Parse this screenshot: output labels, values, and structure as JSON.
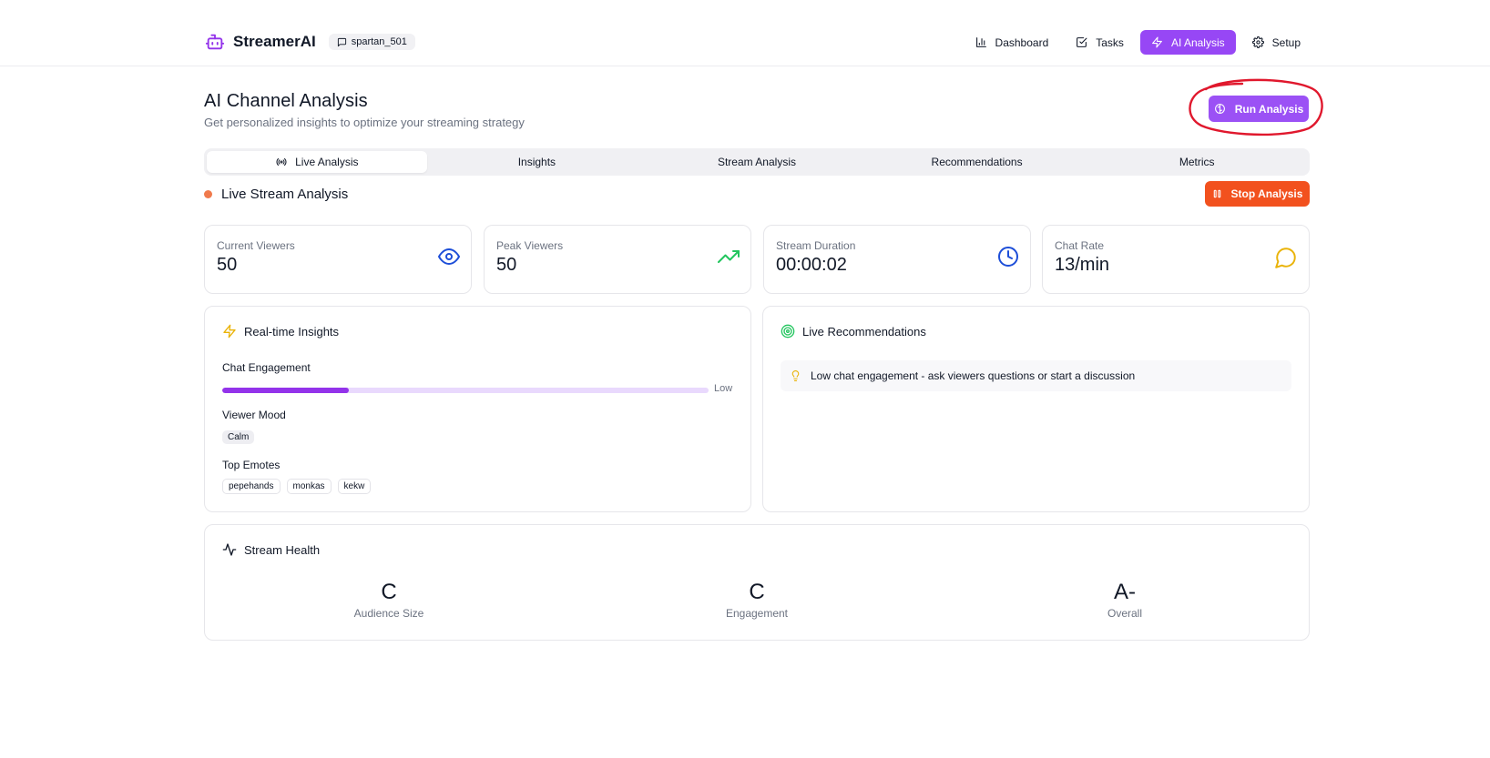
{
  "header": {
    "brand": "StreamerAI",
    "username": "spartan_501",
    "nav": [
      {
        "label": "Dashboard",
        "icon": "bar-chart-icon",
        "active": false
      },
      {
        "label": "Tasks",
        "icon": "check-square-icon",
        "active": false
      },
      {
        "label": "AI Analysis",
        "icon": "zap-icon",
        "active": true
      },
      {
        "label": "Setup",
        "icon": "gear-icon",
        "active": false
      }
    ]
  },
  "page": {
    "title": "AI Channel Analysis",
    "subtitle": "Get personalized insights to optimize your streaming strategy",
    "run_button": "Run Analysis"
  },
  "tabs": [
    {
      "label": "Live Analysis",
      "active": true
    },
    {
      "label": "Insights",
      "active": false
    },
    {
      "label": "Stream Analysis",
      "active": false
    },
    {
      "label": "Recommendations",
      "active": false
    },
    {
      "label": "Metrics",
      "active": false
    }
  ],
  "live": {
    "title": "Live Stream Analysis",
    "stop_button": "Stop Analysis"
  },
  "stats": [
    {
      "label": "Current Viewers",
      "value": "50",
      "icon": "eye-icon",
      "color": "#1d4ed8"
    },
    {
      "label": "Peak Viewers",
      "value": "50",
      "icon": "trending-up-icon",
      "color": "#22c55e"
    },
    {
      "label": "Stream Duration",
      "value": "00:00:02",
      "icon": "clock-icon",
      "color": "#1d4ed8"
    },
    {
      "label": "Chat Rate",
      "value": "13/min",
      "icon": "chat-bubble-icon",
      "color": "#eab308"
    }
  ],
  "insights": {
    "title": "Real-time Insights",
    "engagement_label": "Chat Engagement",
    "engagement_level": 0.26,
    "engagement_text": "Low",
    "mood_label": "Viewer Mood",
    "mood": "Calm",
    "emotes_label": "Top Emotes",
    "emotes": [
      "pepehands",
      "monkas",
      "kekw"
    ]
  },
  "recommendations": {
    "title": "Live Recommendations",
    "items": [
      "Low chat engagement - ask viewers questions or start a discussion"
    ]
  },
  "health": {
    "title": "Stream Health",
    "items": [
      {
        "grade": "C",
        "label": "Audience Size"
      },
      {
        "grade": "C",
        "label": "Engagement"
      },
      {
        "grade": "A-",
        "label": "Overall"
      }
    ]
  },
  "colors": {
    "accent": "#9747f5",
    "stop": "#f2511e",
    "live_dot": "#f07a4c",
    "annotation": "#e0182d"
  }
}
